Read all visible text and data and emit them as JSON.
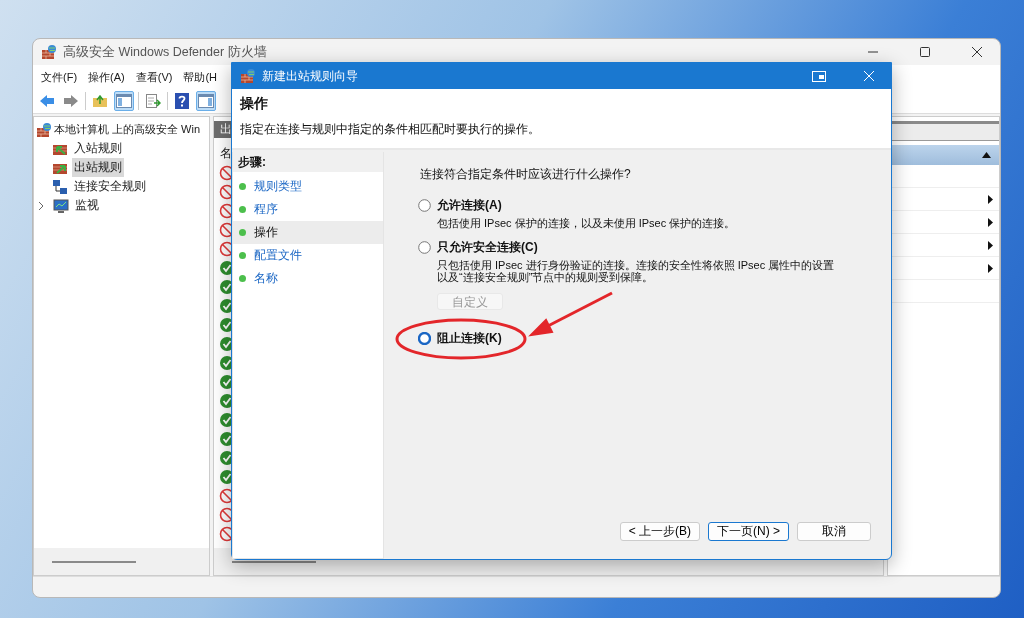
{
  "main_window": {
    "title": "高级安全 Windows Defender 防火墙",
    "menu": [
      {
        "label": "文件(F)"
      },
      {
        "label": "操作(A)"
      },
      {
        "label": "查看(V)"
      },
      {
        "label": "帮助(H"
      }
    ],
    "toolbar": [
      {
        "kind": "back",
        "pressed": false
      },
      {
        "kind": "forward",
        "pressed": false
      },
      {
        "kind": "separator"
      },
      {
        "kind": "up",
        "pressed": false
      },
      {
        "kind": "tree",
        "pressed": true
      },
      {
        "kind": "separator"
      },
      {
        "kind": "export",
        "pressed": false
      },
      {
        "kind": "separator"
      },
      {
        "kind": "help",
        "pressed": false
      },
      {
        "kind": "actionpane",
        "pressed": true
      }
    ],
    "tree": {
      "label": "本地计算机 上的高级安全 Win",
      "children": [
        {
          "label": "入站规则",
          "kind": "inbound",
          "selected": false
        },
        {
          "label": "出站规则",
          "kind": "outbound",
          "selected": true
        },
        {
          "label": "连接安全规则",
          "kind": "security",
          "selected": false
        },
        {
          "label": "监视",
          "kind": "monitor",
          "selected": false,
          "expanded": false
        }
      ]
    },
    "rules_pane": {
      "tab": "出",
      "column_1": "名",
      "rows": [
        {
          "kind": "block"
        },
        {
          "kind": "block"
        },
        {
          "kind": "block"
        },
        {
          "kind": "block"
        },
        {
          "kind": "block"
        },
        {
          "kind": "allow"
        },
        {
          "kind": "allow"
        },
        {
          "kind": "allow"
        },
        {
          "kind": "allow"
        },
        {
          "kind": "allow"
        },
        {
          "kind": "allow"
        },
        {
          "kind": "allow"
        },
        {
          "kind": "allow"
        },
        {
          "kind": "allow"
        },
        {
          "kind": "allow"
        },
        {
          "kind": "allow"
        },
        {
          "kind": "allow"
        },
        {
          "kind": "block"
        },
        {
          "kind": "block"
        },
        {
          "kind": "block"
        }
      ]
    },
    "actions_pane": {
      "section_expanded": true,
      "rows": [
        {
          "submenu": false
        },
        {
          "submenu": true
        },
        {
          "submenu": true
        },
        {
          "submenu": true
        },
        {
          "submenu": true
        },
        {
          "submenu": false
        }
      ]
    }
  },
  "dialog": {
    "title": "新建出站规则向导",
    "heading": "操作",
    "subtitle": "指定在连接与规则中指定的条件相匹配时要执行的操作。",
    "steps_title": "步骤:",
    "steps": [
      {
        "label": "规则类型",
        "selected": false
      },
      {
        "label": "程序",
        "selected": false
      },
      {
        "label": "操作",
        "selected": true
      },
      {
        "label": "配置文件",
        "selected": false
      },
      {
        "label": "名称",
        "selected": false
      }
    ],
    "question": "连接符合指定条件时应该进行什么操作?",
    "options": [
      {
        "label": "允许连接(A)",
        "description": "包括使用 IPsec 保护的连接，以及未使用 IPsec 保护的连接。",
        "selected": false
      },
      {
        "label": "只允许安全连接(C)",
        "description": "只包括使用 IPsec 进行身份验证的连接。连接的安全性将依照 IPsec 属性中的设置以及“连接安全规则”节点中的规则受到保障。",
        "selected": false,
        "button": {
          "label": "自定义",
          "disabled": true
        }
      },
      {
        "label": "阻止连接(K)",
        "selected": true
      }
    ],
    "buttons": [
      {
        "label": "< 上一步(B)",
        "default": false
      },
      {
        "label": "下一页(N) >",
        "default": true
      },
      {
        "label": "取消",
        "default": false
      }
    ]
  }
}
